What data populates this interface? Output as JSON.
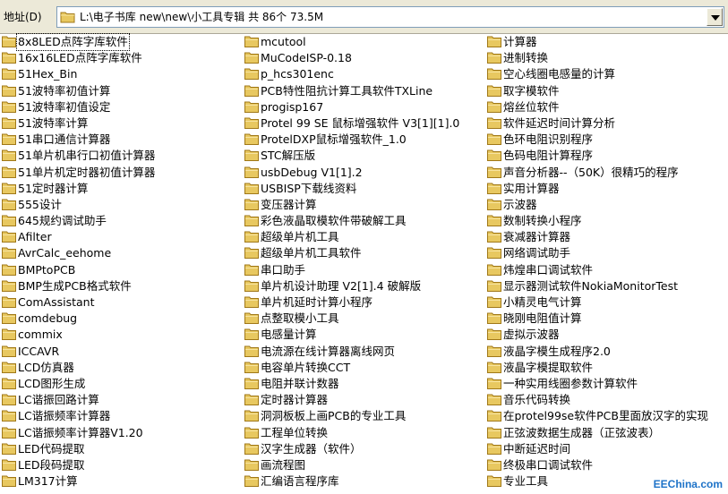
{
  "address_bar": {
    "label": "地址(D)",
    "path": "L:\\电子书库 new\\new\\小工具专辑 共 86个 73.5M",
    "icon": "folder-icon"
  },
  "colors": {
    "folder_body": "#e8c860",
    "folder_edge": "#a07818",
    "watermark": "#1e73c8"
  },
  "files": {
    "columns": [
      [
        "8x8LED点阵字库软件",
        "16x16LED点阵字库软件",
        "51Hex_Bin",
        "51波特率初值计算",
        "51波特率初值设定",
        "51波特率计算",
        "51串口通信计算器",
        "51单片机串行口初值计算器",
        "51单片机定时器初值计算器",
        "51定时器计算",
        "555设计",
        "645规约调试助手",
        "Afilter",
        "AvrCalc_eehome",
        "BMPtoPCB",
        "BMP生成PCB格式软件",
        "ComAssistant",
        "comdebug",
        "commix",
        "ICCAVR",
        "LCD仿真器",
        "LCD图形生成",
        "LC谐振回路计算",
        "LC谐振频率计算器",
        "LC谐振频率计算器V1.20",
        "LED代码提取",
        "LED段码提取",
        "LM317计算"
      ],
      [
        "mcutool",
        "MuCodeISP-0.18",
        "p_hcs301enc",
        "PCB特性阻抗计算工具软件TXLine",
        "progisp167",
        "Protel 99 SE 鼠标增强软件 V3[1][1].0",
        "ProtelDXP鼠标增强软件_1.0",
        "STC解压版",
        "usbDebug V1[1].2",
        "USBISP下载线资料",
        "变压器计算",
        "彩色液晶取模软件带破解工具",
        "超级单片机工具",
        "超级单片机工具软件",
        "串口助手",
        "单片机设计助理 V2[1].4 破解版",
        "单片机延时计算小程序",
        "点整取模小工具",
        "电感量计算",
        "电流源在线计算器离线网页",
        "电容单片转换CCT",
        "电阻并联计数器",
        "定时器计算器",
        "洞洞板板上画PCB的专业工具",
        "工程单位转换",
        "汉字生成器（软件）",
        "画流程图",
        "汇编语言程序库"
      ],
      [
        "计算器",
        "进制转换",
        "空心线圈电感量的计算",
        "取字模软件",
        "熔丝位软件",
        "软件延迟时间计算分析",
        "色环电阻识别程序",
        "色码电阻计算程序",
        "声音分析器--（50K）很精巧的程序",
        "实用计算器",
        "示波器",
        "数制转换小程序",
        "衰减器计算器",
        "网络调试助手",
        "炜煌串口调试软件",
        "显示器测试软件NokiaMonitorTest",
        "小精灵电气计算",
        "晓刚电阻值计算",
        "虚拟示波器",
        "液晶字模生成程序2.0",
        "液晶字模提取软件",
        "一种实用线圈参数计算软件",
        "音乐代码转换",
        "在protel99se软件PCB里面放汉字的实现",
        "正弦波数据生成器（正弦波表）",
        "中断延迟时间",
        "终极串口调试软件",
        "专业工具"
      ]
    ]
  },
  "watermark": "EEChina.com"
}
